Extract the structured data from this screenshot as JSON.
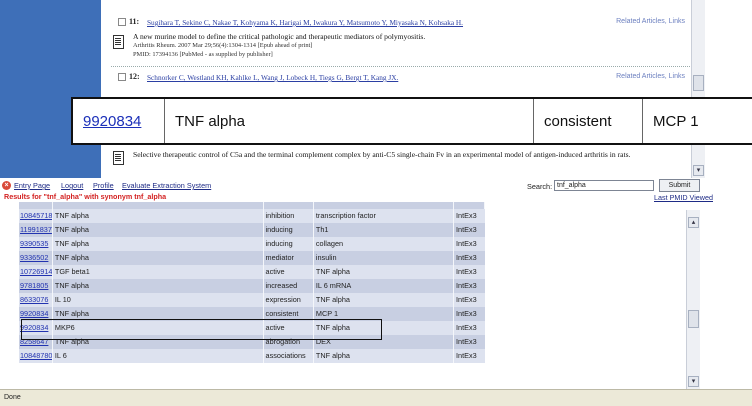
{
  "pubmed": {
    "entries": [
      {
        "number": "11:",
        "authors": "Sugihara T, Sekine C, Nakae T, Kohyama K, Harigai M, Iwakura Y, Matsumoto Y, Miyasaka N, Kohsaka H.",
        "related": "Related Articles, Links",
        "title": "A new murine model to define the critical pathologic and therapeutic mediators of polymyositis.",
        "journal": "Arthritis Rheum. 2007 Mar 29;56(4):1304-1314 [Epub ahead of print]",
        "pmid_line": "PMID: 17394136 [PubMed - as supplied by publisher]"
      },
      {
        "number": "12:",
        "authors": "Schnorker C, Westland KH, Kahlke L, Wang J, Lobeck H, Tiegs G, Bergt T, Kang JX.",
        "related": "Related Articles, Links",
        "title": "Selective therapeutic control of C5a and the terminal complement complex by anti-C5 single-chain Fv in an experimental model of antigen-induced arthritis in rats."
      }
    ]
  },
  "callout": {
    "pmid": "9920834",
    "entity": "TNF alpha",
    "relation": "consistent",
    "target": "MCP 1"
  },
  "toolbar": {
    "links": [
      "Entry Page",
      "Logout",
      "Profile",
      "Evaluate Extraction System"
    ],
    "results_text": "Results for \"tnf_alpha\" with synonym tnf_alpha",
    "search_label": "Search:",
    "search_value": "tnf_alpha",
    "submit_label": "Submit",
    "last_pmid_label": "Last PMID Viewed"
  },
  "table": {
    "rows": [
      {
        "pmid": "10845718",
        "entity": "TNF alpha",
        "relation": "inhibition",
        "target": "transcription factor",
        "method": "IntEx3"
      },
      {
        "pmid": "11991837",
        "entity": "TNF alpha",
        "relation": "inducing",
        "target": "Th1",
        "method": "IntEx3"
      },
      {
        "pmid": "9390535",
        "entity": "TNF alpha",
        "relation": "inducing",
        "target": "collagen",
        "method": "IntEx3"
      },
      {
        "pmid": "9336502",
        "entity": "TNF alpha",
        "relation": "mediator",
        "target": "insulin",
        "method": "IntEx3"
      },
      {
        "pmid": "10726914",
        "entity": "TGF beta1",
        "relation": "active",
        "target": "TNF alpha",
        "method": "IntEx3"
      },
      {
        "pmid": "9781805",
        "entity": "TNF alpha",
        "relation": "increased",
        "target": "IL 6 mRNA",
        "method": "IntEx3"
      },
      {
        "pmid": "8633076",
        "entity": "IL 10",
        "relation": "expression",
        "target": "TNF alpha",
        "method": "IntEx3"
      },
      {
        "pmid": "9920834",
        "entity": "TNF alpha",
        "relation": "consistent",
        "target": "MCP 1",
        "method": "IntEx3"
      },
      {
        "pmid": "9920834",
        "entity": "MKP6",
        "relation": "active",
        "target": "TNF alpha",
        "method": "IntEx3"
      },
      {
        "pmid": "8258647",
        "entity": "TNF alpha",
        "relation": "abrogation",
        "target": "DEX",
        "method": "IntEx3"
      },
      {
        "pmid": "10848780",
        "entity": "IL 6",
        "relation": "associations",
        "target": "TNF alpha",
        "method": "IntEx3"
      }
    ]
  },
  "status_bar": {
    "text": "Done"
  }
}
